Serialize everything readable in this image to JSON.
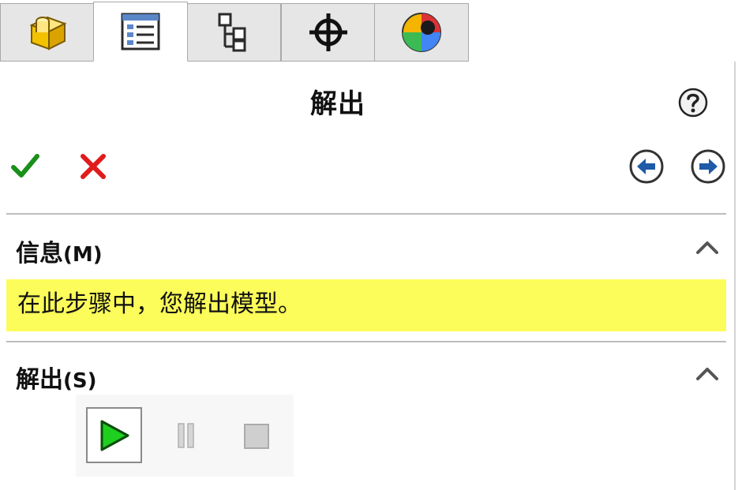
{
  "tabs": [
    {
      "icon": "part-icon",
      "active": false
    },
    {
      "icon": "property-manager-icon",
      "active": true
    },
    {
      "icon": "configuration-manager-icon",
      "active": false
    },
    {
      "icon": "dimxpert-icon",
      "active": false
    },
    {
      "icon": "display-manager-icon",
      "active": false
    }
  ],
  "header": {
    "title": "解出",
    "help_icon": "help-icon"
  },
  "actions": {
    "ok_icon": "checkmark-icon",
    "cancel_icon": "close-icon",
    "back_icon": "arrow-left-icon",
    "forward_icon": "arrow-right-icon"
  },
  "info_section": {
    "title": "信息",
    "key": "(M)",
    "message": "在此步骤中，您解出模型。"
  },
  "solve_section": {
    "title": "解出",
    "key": "(S)",
    "controls": [
      {
        "icon": "play-icon",
        "enabled": true
      },
      {
        "icon": "pause-icon",
        "enabled": false
      },
      {
        "icon": "stop-icon",
        "enabled": false
      }
    ]
  },
  "colors": {
    "accent_ok": "#1a8f1a",
    "accent_cancel": "#e01b1b",
    "message_bg": "#fcfc5a",
    "nav_blue": "#1e5aa8"
  }
}
